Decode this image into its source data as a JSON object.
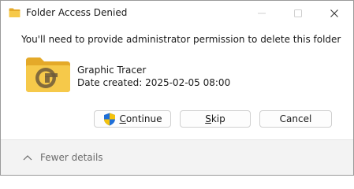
{
  "window": {
    "title": "Folder Access Denied",
    "icon": "folder-icon"
  },
  "caption_buttons": {
    "minimize": "minimize-icon",
    "maximize": "maximize-icon",
    "close": "close-icon"
  },
  "dialog": {
    "message": "You'll need to provide administrator permission to delete this folder",
    "item": {
      "name": "Graphic Tracer",
      "date_label": "Date created: 2025-02-05 08:00",
      "icon": "folder-icon"
    }
  },
  "buttons": {
    "continue_underlined": "C",
    "continue_rest": "ontinue",
    "skip_underlined": "S",
    "skip_rest": "kip",
    "cancel": "Cancel"
  },
  "footer": {
    "details_label": "Fewer details"
  },
  "colors": {
    "folder": "#f6c94a",
    "folder_dark": "#e4a929",
    "shield_blue": "#1f6fd8",
    "shield_yellow": "#f4c20d",
    "footer_bg": "#f3f3f3"
  }
}
